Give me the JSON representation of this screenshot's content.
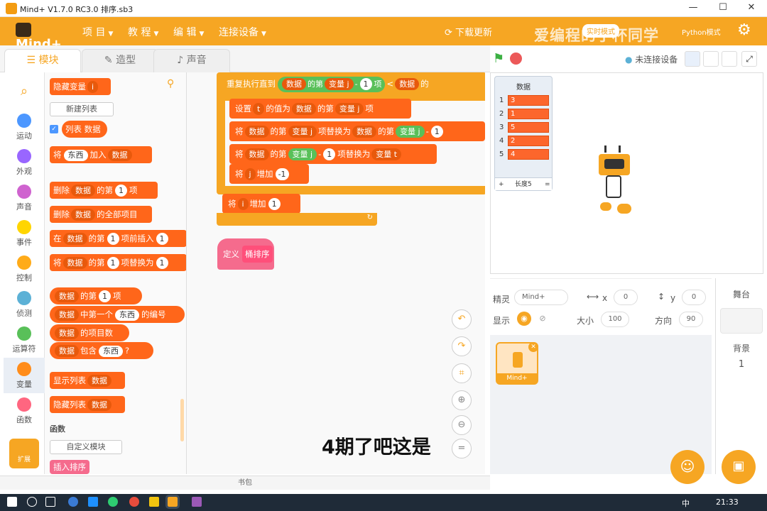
{
  "window": {
    "title": "Mind+ V1.7.0 RC3.0   排序.sb3",
    "minimize": "—",
    "maximize": "☐",
    "close": "✕"
  },
  "menubar": {
    "brand": "Mind+",
    "items": [
      "项 目",
      "教 程",
      "编 辑",
      "连接设备"
    ],
    "update": "下载更新",
    "watermark": "爱编程的了杯同学",
    "mode_badge": "实时模式",
    "python_label": "Python模式"
  },
  "tabs": [
    {
      "label": "模块",
      "active": true
    },
    {
      "label": "造型",
      "active": false
    },
    {
      "label": "声音",
      "active": false
    }
  ],
  "categories": [
    "运动",
    "外观",
    "声音",
    "事件",
    "控制",
    "侦测",
    "运算符",
    "变量",
    "函数"
  ],
  "category_colors": [
    "#4c97ff",
    "#9966ff",
    "#cf63cf",
    "#ffd500",
    "#ffab19",
    "#5cb1d6",
    "#59c059",
    "#ff8c1a",
    "#ff6680"
  ],
  "extension_label": "扩展",
  "palette": {
    "hide_var": "隐藏变量",
    "var_i": "i",
    "new_list": "新建列表",
    "list_name": "列表 数据",
    "add": [
      "将",
      "东西",
      "加入",
      "数据"
    ],
    "del": [
      "删除",
      "数据",
      "的第",
      "1",
      "项"
    ],
    "del_all": [
      "删除",
      "数据",
      "的全部项目"
    ],
    "insert": [
      "在",
      "数据",
      "的第",
      "1",
      "项前插入",
      "1"
    ],
    "replace": [
      "将",
      "数据",
      "的第",
      "1",
      "项替换为",
      "1"
    ],
    "item": [
      "数据",
      "的第",
      "1",
      "项"
    ],
    "index_of": [
      "数据",
      "中第一个",
      "东西",
      "的编号"
    ],
    "length": [
      "数据",
      "的项目数"
    ],
    "contains": [
      "数据",
      "包含",
      "东西",
      "?"
    ],
    "show_list": [
      "显示列表",
      "数据"
    ],
    "hide_list": [
      "隐藏列表",
      "数据"
    ],
    "func_header": "函数",
    "custom_block": "自定义模块",
    "insert_sort": "插入排序"
  },
  "code": {
    "repeat": [
      "重复执行直到",
      "数据",
      "的第",
      "变量 j",
      "-",
      "1",
      "项",
      "<",
      "数据",
      "的"
    ],
    "set": [
      "设置",
      "t",
      "的值为",
      "数据",
      "的第",
      "变量 j",
      "项"
    ],
    "rep1": [
      "将",
      "数据",
      "的第",
      "变量 j",
      "项替换为",
      "数据",
      "的第",
      "变量 j",
      "-",
      "1"
    ],
    "rep2": [
      "将",
      "数据",
      "的第",
      "变量 j",
      "-",
      "1",
      "项替换为",
      "变量 t"
    ],
    "incj": [
      "将",
      "j",
      "增加",
      "-1"
    ],
    "inci": [
      "将",
      "i",
      "增加",
      "1"
    ],
    "define": [
      "定义",
      "桶排序"
    ]
  },
  "subtitle": "4期了吧这是",
  "stage_bar": {
    "status": "未连接设备"
  },
  "list_monitor": {
    "title": "数据",
    "items": [
      "3",
      "1",
      "5",
      "2",
      "4"
    ],
    "footer_plus": "+",
    "footer": "长度5",
    "footer_eq": "="
  },
  "sprite_info": {
    "sprite_label": "精灵",
    "sprite_name": "Mind+",
    "x_label": "x",
    "x": "0",
    "y_label": "y",
    "y": "0",
    "show_label": "显示",
    "size_label": "大小",
    "size": "100",
    "dir_label": "方向",
    "dir": "90"
  },
  "sprite_thumb": "Mind+",
  "stage_panel": {
    "title": "舞台",
    "bg_label": "背景",
    "bg_count": "1"
  },
  "backpack": "书包",
  "taskbar": {
    "time": "21:33",
    "ime": "中"
  }
}
